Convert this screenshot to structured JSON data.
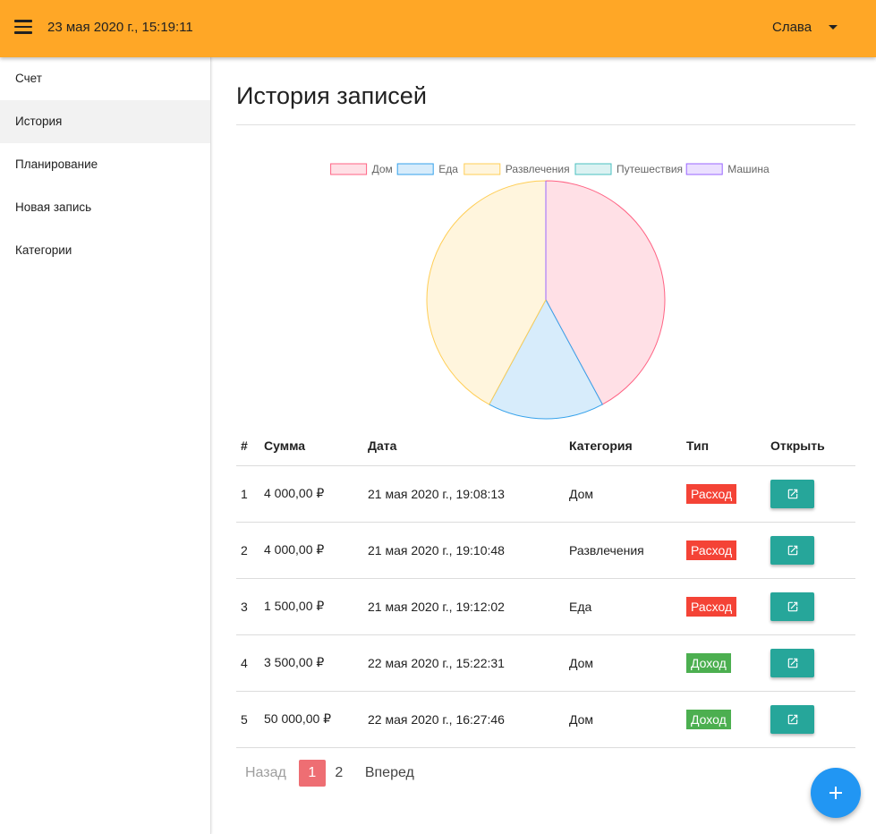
{
  "header": {
    "datetime": "23 мая 2020 г., 15:19:11",
    "user_name": "Слава",
    "bg_color": "#ffa726"
  },
  "sidebar": {
    "items": [
      {
        "label": "Счет"
      },
      {
        "label": "История"
      },
      {
        "label": "Планирование"
      },
      {
        "label": "Новая запись"
      },
      {
        "label": "Категории"
      }
    ]
  },
  "page": {
    "title": "История записей"
  },
  "chart_data": {
    "type": "pie",
    "categories": [
      "Дом",
      "Еда",
      "Развлечения",
      "Путешествия",
      "Машина"
    ],
    "values": [
      4000,
      1500,
      4000,
      0,
      0
    ],
    "colors": [
      {
        "fill": "#ffe0e6",
        "stroke": "#ff6384"
      },
      {
        "fill": "#d7ecfb",
        "stroke": "#36a2eb"
      },
      {
        "fill": "#fff5dd",
        "stroke": "#ffce56"
      },
      {
        "fill": "#dbf2f2",
        "stroke": "#4bc0c0"
      },
      {
        "fill": "#ebe0ff",
        "stroke": "#9966ff"
      }
    ],
    "legend": "top"
  },
  "table": {
    "headers": [
      "#",
      "Сумма",
      "Дата",
      "Категория",
      "Тип",
      "Открыть"
    ],
    "rows": [
      {
        "num": "1",
        "sum": "4 000,00 ₽",
        "date": "21 мая 2020 г., 19:08:13",
        "category": "Дом",
        "type": "Расход"
      },
      {
        "num": "2",
        "sum": "4 000,00 ₽",
        "date": "21 мая 2020 г., 19:10:48",
        "category": "Развлечения",
        "type": "Расход"
      },
      {
        "num": "3",
        "sum": "1 500,00 ₽",
        "date": "21 мая 2020 г., 19:12:02",
        "category": "Еда",
        "type": "Расход"
      },
      {
        "num": "4",
        "sum": "3 500,00 ₽",
        "date": "22 мая 2020 г., 15:22:31",
        "category": "Дом",
        "type": "Доход"
      },
      {
        "num": "5",
        "sum": "50 000,00 ₽",
        "date": "22 мая 2020 г., 16:27:46",
        "category": "Дом",
        "type": "Доход"
      }
    ],
    "expense_color": "#f44336",
    "income_color": "#4caf50",
    "open_icon": "open-in-new-icon"
  },
  "pagination": {
    "prev": "Назад",
    "pages": [
      "1",
      "2"
    ],
    "next": "Вперед"
  },
  "fab": {
    "icon": "plus-icon",
    "color": "#2196f3"
  }
}
